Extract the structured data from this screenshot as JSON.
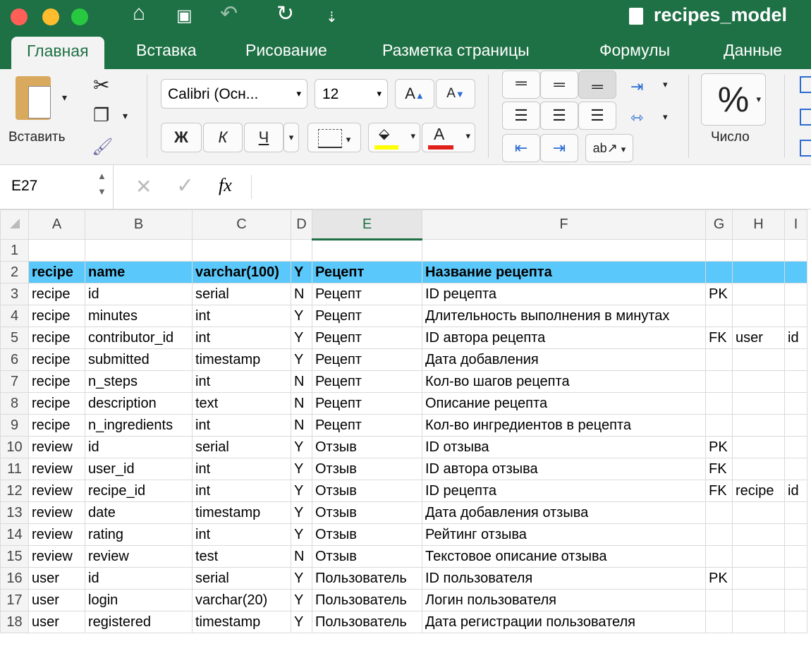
{
  "app": {
    "title": "recipes_model"
  },
  "tabs": [
    "Главная",
    "Вставка",
    "Рисование",
    "Разметка страницы",
    "Формулы",
    "Данные"
  ],
  "ribbon": {
    "paste_label": "Вставить",
    "font_name": "Calibri (Осн...",
    "font_size": "12",
    "bold": "Ж",
    "italic": "К",
    "underline": "Ч",
    "number_label": "Число",
    "percent": "%"
  },
  "formula_bar": {
    "cell_ref": "E27",
    "fx": "fx",
    "value": ""
  },
  "columns": [
    "A",
    "B",
    "C",
    "D",
    "E",
    "F",
    "G",
    "H",
    "I"
  ],
  "rows": [
    [
      "",
      "",
      "",
      "",
      "",
      "",
      "",
      "",
      ""
    ],
    [
      "recipe",
      "name",
      "varchar(100)",
      "Y",
      "Рецепт",
      "Название рецепта",
      "",
      "",
      ""
    ],
    [
      "recipe",
      "id",
      "serial",
      "N",
      "Рецепт",
      "ID рецепта",
      "PK",
      "",
      ""
    ],
    [
      "recipe",
      "minutes",
      "int",
      "Y",
      "Рецепт",
      "Длительность выполнения в минутах",
      "",
      "",
      ""
    ],
    [
      "recipe",
      "contributor_id",
      "int",
      "Y",
      "Рецепт",
      "ID автора рецепта",
      "FK",
      "user",
      "id"
    ],
    [
      "recipe",
      "submitted",
      "timestamp",
      "Y",
      "Рецепт",
      "Дата добавления",
      "",
      "",
      ""
    ],
    [
      "recipe",
      "n_steps",
      "int",
      "N",
      "Рецепт",
      "Кол-во шагов рецепта",
      "",
      "",
      ""
    ],
    [
      "recipe",
      "description",
      "text",
      "N",
      "Рецепт",
      "Описание рецепта",
      "",
      "",
      ""
    ],
    [
      "recipe",
      "n_ingredients",
      "int",
      "N",
      "Рецепт",
      "Кол-во ингредиентов в рецепта",
      "",
      "",
      ""
    ],
    [
      "review",
      "id",
      "serial",
      "Y",
      "Отзыв",
      "ID отзыва",
      "PK",
      "",
      ""
    ],
    [
      "review",
      "user_id",
      "int",
      "Y",
      "Отзыв",
      "ID автора отзыва",
      "FK",
      "",
      ""
    ],
    [
      "review",
      "recipe_id",
      "int",
      "Y",
      "Отзыв",
      "ID рецепта",
      "FK",
      "recipe",
      "id"
    ],
    [
      "review",
      "date",
      "timestamp",
      "Y",
      "Отзыв",
      "Дата добавления отзыва",
      "",
      "",
      ""
    ],
    [
      "review",
      "rating",
      "int",
      "Y",
      "Отзыв",
      "Рейтинг отзыва",
      "",
      "",
      ""
    ],
    [
      "review",
      "review",
      "test",
      "N",
      "Отзыв",
      "Текстовое описание отзыва",
      "",
      "",
      ""
    ],
    [
      "user",
      "id",
      "serial",
      "Y",
      "Пользователь",
      "ID пользователя",
      "PK",
      "",
      ""
    ],
    [
      "user",
      "login",
      "varchar(20)",
      "Y",
      "Пользователь",
      "Логин пользователя",
      "",
      "",
      ""
    ],
    [
      "user",
      "registered",
      "timestamp",
      "Y",
      "Пользователь",
      "Дата регистрации пользователя",
      "",
      "",
      ""
    ]
  ],
  "colors": {
    "header_row": "#5ac8fa",
    "brand": "#1e7145"
  }
}
